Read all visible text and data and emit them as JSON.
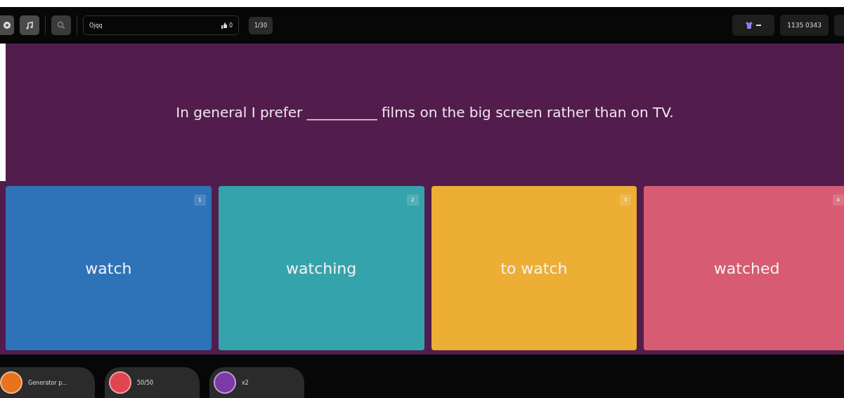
{
  "top_bar": {
    "player_name": "Ojqq",
    "likes": "0",
    "question_counter": "1/30",
    "score": "1135 0343"
  },
  "question": "In general I prefer __________ films on the big screen rather than on TV.",
  "answers": [
    {
      "key": "1",
      "text": "watch",
      "color": "#2e72b8"
    },
    {
      "key": "2",
      "text": "watching",
      "color": "#35a3ab"
    },
    {
      "key": "3",
      "text": "to watch",
      "color": "#ecae35"
    },
    {
      "key": "4",
      "text": "watched",
      "color": "#d75b72"
    }
  ],
  "powerups": [
    {
      "label": "Generator p...",
      "color": "#e8731c"
    },
    {
      "label": "50/50",
      "color": "#e0454f"
    },
    {
      "label": "x2",
      "color": "#7a3aa8"
    }
  ]
}
